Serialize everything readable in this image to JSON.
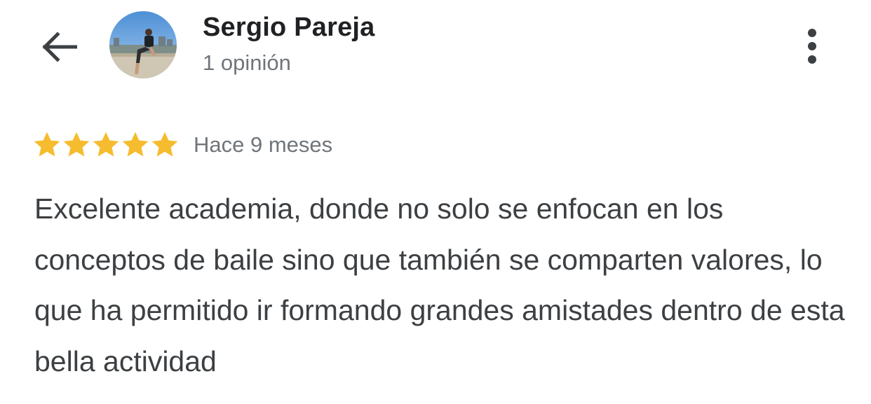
{
  "header": {
    "back_icon": "arrow-left-icon",
    "user_name": "Sergio Pareja",
    "review_count": "1 opinión",
    "more_icon": "more-vert-icon"
  },
  "review": {
    "rating": 5,
    "max_rating": 5,
    "time_ago": "Hace 9 meses",
    "text": "Excelente academia, donde no solo se enfocan en los conceptos de baile sino que también se comparten valores, lo que ha permitido ir formando grandes amistades dentro de esta bella actividad"
  },
  "colors": {
    "star": "#f6bc2f",
    "name": "#202124",
    "meta": "#70757a",
    "body": "#3c4043"
  }
}
